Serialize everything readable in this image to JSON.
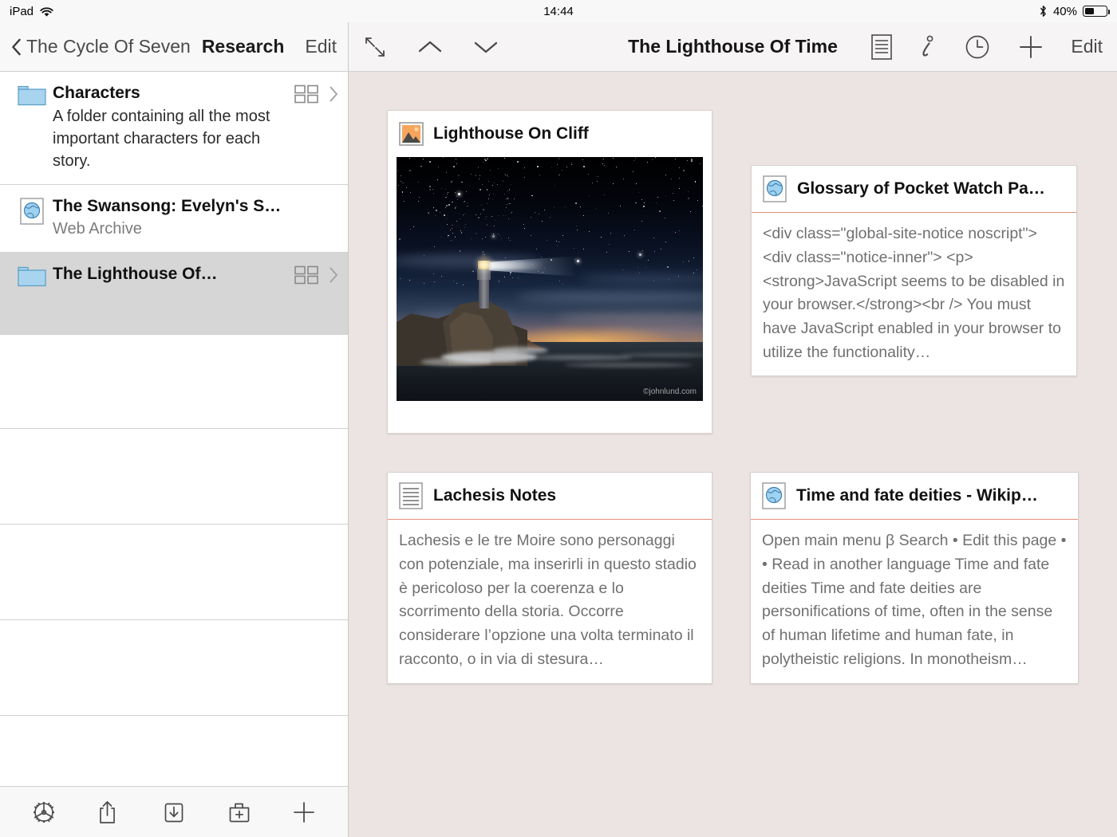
{
  "status_bar": {
    "device": "iPad",
    "wifi_icon": "wifi-icon",
    "time": "14:44",
    "bluetooth_icon": "bluetooth-icon",
    "battery_percent": "40%",
    "battery_level": 40
  },
  "sidebar": {
    "nav": {
      "back_icon": "chevron-left-icon",
      "back_label": "The Cycle Of Seven",
      "title": "Research",
      "edit_label": "Edit"
    },
    "rows": [
      {
        "icon": "folder-icon",
        "title": "Characters",
        "subtitle": "A folder containing all the most important characters for each story.",
        "subtitle_muted": false,
        "grid_icon": "grid-view-icon",
        "chevron_icon": "chevron-right-icon",
        "selected": false
      },
      {
        "icon": "web-archive-icon",
        "title": "The Swansong: Evelyn's S…",
        "subtitle": "Web Archive",
        "subtitle_muted": true,
        "grid_icon": "",
        "chevron_icon": "",
        "selected": false
      },
      {
        "icon": "folder-icon",
        "title": "The Lighthouse Of…",
        "subtitle": "",
        "subtitle_muted": false,
        "grid_icon": "grid-view-icon",
        "chevron_icon": "chevron-right-icon",
        "selected": true
      }
    ],
    "toolbar": [
      {
        "name": "settings-gear-icon",
        "label": "Settings"
      },
      {
        "name": "share-icon",
        "label": "Share"
      },
      {
        "name": "import-download-icon",
        "label": "Import"
      },
      {
        "name": "new-folder-icon",
        "label": "New Folder"
      },
      {
        "name": "add-plus-icon",
        "label": "Add"
      }
    ]
  },
  "detail": {
    "nav": {
      "expand_icon": "expand-diagonal-icon",
      "prev_icon": "chevron-up-icon",
      "next_icon": "chevron-down-icon",
      "title": "The Lighthouse Of Time",
      "list_icon": "document-list-icon",
      "info_icon": "info-italic-icon",
      "history_icon": "clock-history-icon",
      "add_icon": "plus-icon",
      "edit_label": "Edit"
    },
    "cards": [
      {
        "id": "lighthouse-on-cliff",
        "icon": "image-thumbnail-icon",
        "title": "Lighthouse On Cliff",
        "type": "image",
        "ruled": false,
        "image_watermark": "©johnlund.com",
        "preview": ""
      },
      {
        "id": "glossary-of-pocket-watch-parts",
        "icon": "web-archive-icon",
        "title": "Glossary of Pocket Watch Pa…",
        "type": "text",
        "ruled": true,
        "preview": "<div class=\"global-site-notice noscript\"> <div class=\"notice-inner\"> <p> <strong>JavaScript seems to be disabled in your browser.</strong><br /> You must have JavaScript enabled in your browser to utilize the functionality…"
      },
      {
        "id": "lachesis-notes",
        "icon": "text-document-icon",
        "title": "Lachesis Notes",
        "type": "text",
        "ruled": true,
        "preview": "Lachesis e le tre Moire sono personaggi con potenziale, ma inserirli in questo stadio è pericoloso per la coerenza e lo scorrimento della storia. Occorre considerare l’opzione una volta terminato il racconto, o in via di stesura…"
      },
      {
        "id": "time-and-fate-deities-wikipedia",
        "icon": "web-archive-icon",
        "title": "Time and fate deities - Wikip…",
        "type": "text",
        "ruled": true,
        "preview": "Open main menu β  Search • Edit this page •  • Read in another language Time and fate deities Time and fate deities are personifications of time, often in the sense of human lifetime and human fate, in polytheistic religions. In monotheism…"
      }
    ]
  },
  "colors": {
    "detail_background": "#EBE4E2",
    "card_rule": "#E79079",
    "folder_blue": "#A8D4EF",
    "selection_gray": "#D6D6D6",
    "chrome_gray": "#F8F8F8"
  }
}
